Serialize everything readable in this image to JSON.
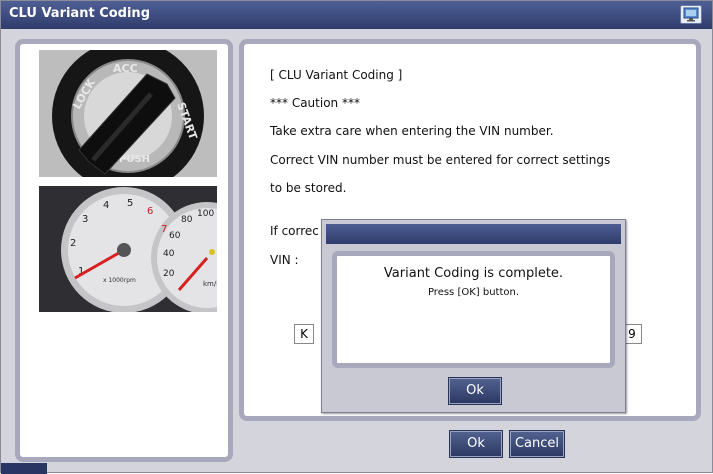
{
  "window": {
    "title": "CLU Variant Coding"
  },
  "icons": {
    "title_icon": "monitor-icon"
  },
  "content": {
    "heading": "[ CLU Variant Coding ]",
    "caution": "*** Caution ***",
    "line1": "Take extra care when entering the VIN number.",
    "line2": "Correct VIN number must be entered for correct settings",
    "line3": "to be stored.",
    "line4": "If correc",
    "vin_label": "VIN :",
    "vin_first": "K",
    "vin_last": "9"
  },
  "dialog": {
    "message": "Variant Coding is complete.",
    "instruction": "Press [OK] button.",
    "ok_label": "Ok"
  },
  "footer": {
    "ok_label": "Ok",
    "cancel_label": "Cancel"
  },
  "images": {
    "ignition_labels": [
      "LOCK",
      "ACC",
      "START",
      "PUSH"
    ],
    "gauge_labels": [
      "1",
      "2",
      "3",
      "4",
      "5",
      "6",
      "7",
      "x 1000rpm",
      "100",
      "80",
      "60",
      "40",
      "20",
      "km/h"
    ]
  }
}
